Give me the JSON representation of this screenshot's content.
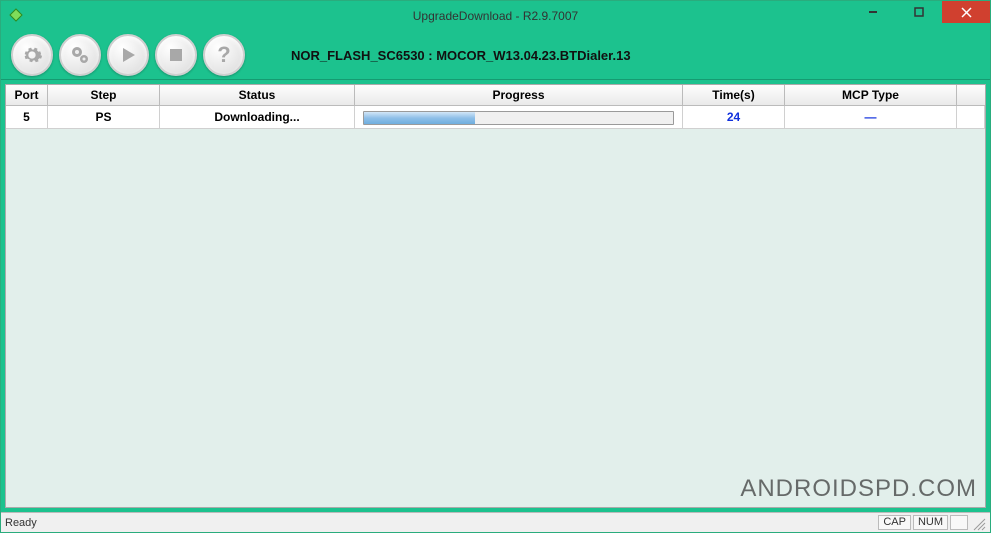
{
  "window": {
    "title": "UpgradeDownload - R2.9.7007"
  },
  "toolbar": {
    "flash_label": "NOR_FLASH_SC6530 : MOCOR_W13.04.23.BTDialer.13"
  },
  "icons": {
    "settings": "gear-icon",
    "settings2": "double-gear-icon",
    "start": "play-icon",
    "stop": "stop-icon",
    "help": "question-icon"
  },
  "columns": {
    "port": "Port",
    "step": "Step",
    "status": "Status",
    "progress": "Progress",
    "time": "Time(s)",
    "mcp": "MCP Type"
  },
  "rows": [
    {
      "port": "5",
      "step": "PS",
      "status": "Downloading...",
      "progress_percent": 36,
      "time": "24",
      "mcp": "—"
    }
  ],
  "watermark": "ANDROIDSPD.COM",
  "statusbar": {
    "ready": "Ready",
    "cap": "CAP",
    "num": "NUM"
  }
}
